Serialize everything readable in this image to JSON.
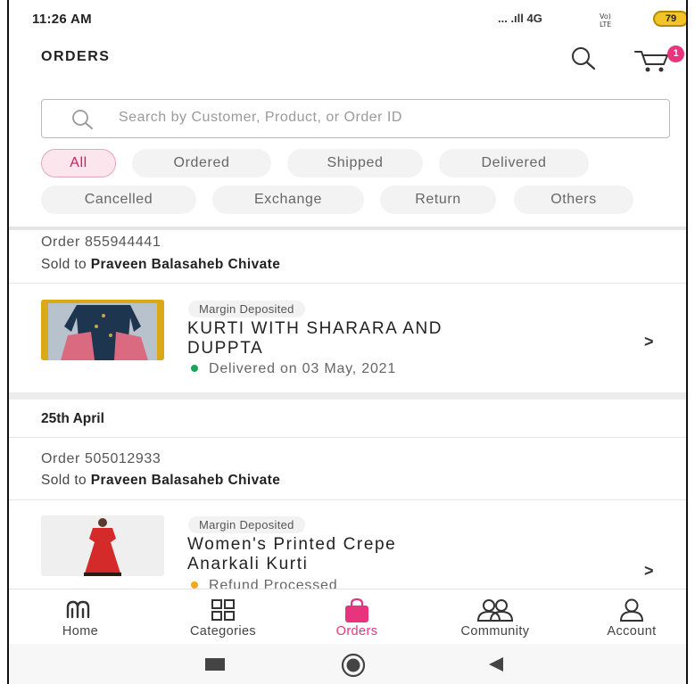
{
  "status_bar": {
    "time": "11:26 AM",
    "network": "... .ıll 4G",
    "battery": "79"
  },
  "header": {
    "title": "ORDERS",
    "cart_count": "1"
  },
  "search": {
    "placeholder": "Search by Customer, Product, or Order ID",
    "value": ""
  },
  "filters": [
    {
      "label": "All",
      "active": true
    },
    {
      "label": "Ordered",
      "active": false
    },
    {
      "label": "Shipped",
      "active": false
    },
    {
      "label": "Delivered",
      "active": false
    },
    {
      "label": "Cancelled",
      "active": false
    },
    {
      "label": "Exchange",
      "active": false
    },
    {
      "label": "Return",
      "active": false
    },
    {
      "label": "Others",
      "active": false
    }
  ],
  "orders": [
    {
      "order_number": "Order 855944441",
      "sold_to_label": "Sold to",
      "customer": "Praveen Balasaheb Chivate",
      "tag": "Margin Deposited",
      "product_line1": "KURTI WITH SHARARA AND",
      "product_line2": "DUPPTA",
      "status": "Delivered on 03 May, 2021",
      "status_color": "#1aa45a"
    },
    {
      "date_header": "25th April",
      "order_number": "Order 505012933",
      "sold_to_label": "Sold to",
      "customer": "Praveen Balasaheb Chivate",
      "tag": "Margin Deposited",
      "product_line1": "Women's Printed Crepe",
      "product_line2": "Anarkali Kurti",
      "status": "Refund Processed",
      "status_color": "#f2a81d"
    }
  ],
  "bottom_nav": [
    {
      "label": "Home",
      "icon": "meesho-logo-icon",
      "active": false
    },
    {
      "label": "Categories",
      "icon": "grid-icon",
      "active": false
    },
    {
      "label": "Orders",
      "icon": "shopping-bag-icon",
      "active": true
    },
    {
      "label": "Community",
      "icon": "people-icon",
      "active": false
    },
    {
      "label": "Account",
      "icon": "user-icon",
      "active": false
    }
  ],
  "colors": {
    "brand": "#e8337d",
    "active_chip_bg": "#fbe6ee",
    "active_chip_border": "#e7a5bd"
  }
}
